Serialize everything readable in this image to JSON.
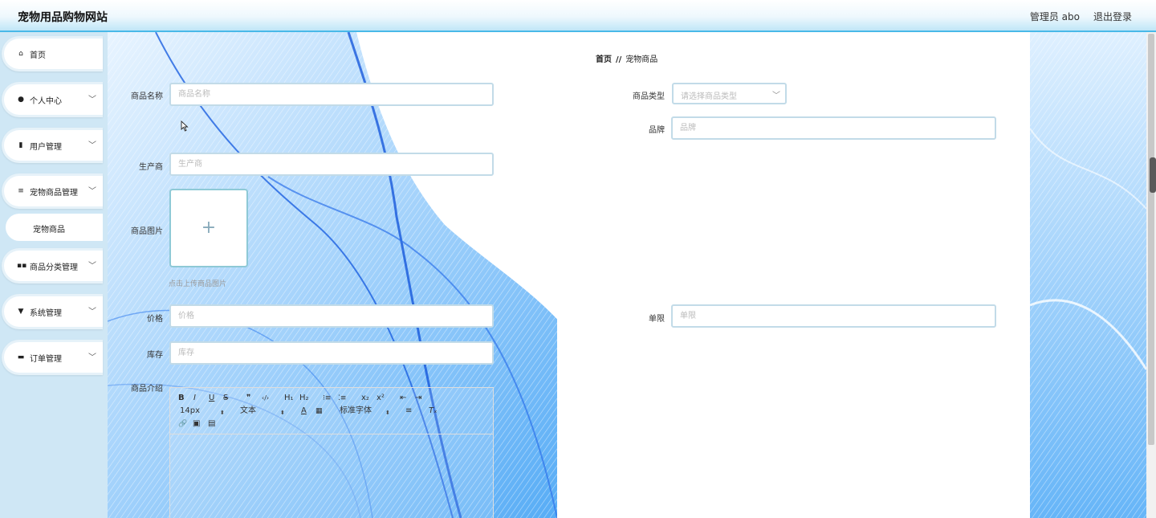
{
  "header": {
    "app_title": "宠物用品购物网站",
    "user_label": "管理员 abo",
    "logout_label": "退出登录"
  },
  "sidebar": {
    "items": [
      {
        "label": "首页",
        "icon": "home-icon",
        "chevron": ""
      },
      {
        "label": "个人中心",
        "icon": "user-icon",
        "chevron": "﹀"
      },
      {
        "label": "用户管理",
        "icon": "bar-chart-icon",
        "chevron": "﹀"
      },
      {
        "label": "宠物商品管理",
        "icon": "list-icon",
        "chevron": "﹀"
      },
      {
        "label": "商品分类管理",
        "icon": "grid-icon",
        "chevron": "﹀"
      },
      {
        "label": "系统管理",
        "icon": "filter-icon",
        "chevron": "﹀"
      },
      {
        "label": "订单管理",
        "icon": "comment-icon",
        "chevron": "﹀"
      }
    ],
    "sub_item": {
      "label": "宠物商品"
    }
  },
  "breadcrumb": {
    "home": "首页",
    "separator": "//",
    "current": "宠物商品"
  },
  "form": {
    "name": {
      "label": "商品名称",
      "placeholder": "商品名称"
    },
    "type": {
      "label": "商品类型",
      "placeholder": "请选择商品类型"
    },
    "brand": {
      "label": "品牌",
      "placeholder": "品牌"
    },
    "maker": {
      "label": "生产商",
      "placeholder": "生产商"
    },
    "image": {
      "label": "商品图片",
      "plus": "+",
      "hint": "点击上传商品图片"
    },
    "price": {
      "label": "价格",
      "placeholder": "价格"
    },
    "limit": {
      "label": "单限",
      "placeholder": "单限"
    },
    "stock": {
      "label": "库存",
      "placeholder": "库存"
    },
    "intro": {
      "label": "商品介绍"
    }
  },
  "editor_toolbar": {
    "bold": "B",
    "italic": "I",
    "underline": "U",
    "strike": "S",
    "quote": "❞",
    "code": "‹/›",
    "h1": "H₁",
    "h2": "H₂",
    "ol": "⁝≡",
    "ul": "⁚≡",
    "sub": "x₂",
    "sup": "x²",
    "outdent": "⇤",
    "indent": "⇥",
    "size": "14px",
    "text": "文本",
    "font": "标准字体",
    "color": "A",
    "bg": "▦",
    "align": "≡",
    "clean": "Tₓ",
    "link": "🔗",
    "image": "▣",
    "video": "▤"
  },
  "colors": {
    "accent": "#49b9e8",
    "sidebar_bg": "#cfe7f5",
    "wave_blue": "#1a73e8"
  }
}
